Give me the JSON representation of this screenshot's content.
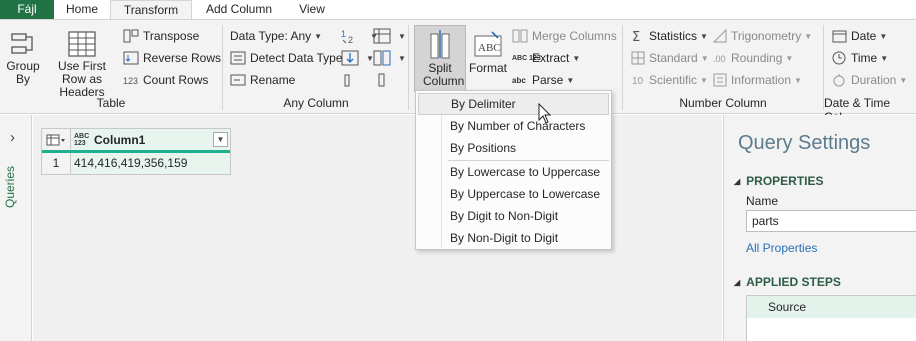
{
  "tabs": {
    "file": "Fájl",
    "home": "Home",
    "transform": "Transform",
    "add_column": "Add Column",
    "view": "View"
  },
  "ribbon": {
    "table_group": {
      "label": "Table",
      "group_by": "Group By",
      "use_first_row": "Use First Row as Headers",
      "transpose": "Transpose",
      "reverse_rows": "Reverse Rows",
      "count_rows": "Count Rows"
    },
    "any_column_group": {
      "label": "Any Column",
      "data_type": "Data Type: Any",
      "detect_data_type": "Detect Data Type",
      "rename": "Rename"
    },
    "text_group": {
      "split_column": "Split Column",
      "format": "Format",
      "merge_columns": "Merge Columns",
      "extract": "Extract",
      "parse": "Parse",
      "abc123": "ABC 123",
      "abc": "abc"
    },
    "number_group": {
      "label": "Number Column",
      "statistics": "Statistics",
      "standard": "Standard",
      "scientific": "Scientific",
      "trigonometry": "Trigonometry",
      "rounding": "Rounding",
      "information": "Information"
    },
    "datetime_group": {
      "label": "Date & Time Col...",
      "date": "Date",
      "time": "Time",
      "duration": "Duration"
    }
  },
  "left_rail": {
    "label": "Queries"
  },
  "grid": {
    "type_badge": "ABC 123",
    "column_header": "Column1",
    "rows": [
      {
        "num": "1",
        "value": "414,416,419,356,159"
      }
    ]
  },
  "split_menu": {
    "items": [
      "By Delimiter",
      "By Number of Characters",
      "By Positions",
      "By Lowercase to Uppercase",
      "By Uppercase to Lowercase",
      "By Digit to Non-Digit",
      "By Non-Digit to Digit"
    ],
    "hovered": "By Delimiter"
  },
  "query_settings": {
    "title": "Query Settings",
    "properties_header": "PROPERTIES",
    "name_label": "Name",
    "name_value": "parts",
    "all_properties": "All Properties",
    "applied_steps_header": "APPLIED STEPS",
    "steps": [
      "Source"
    ]
  },
  "colors": {
    "brand_green": "#217346",
    "accent_teal": "#1fb18f",
    "ribbon_bg": "#f3f3f3",
    "link_blue": "#2a6ebb"
  }
}
